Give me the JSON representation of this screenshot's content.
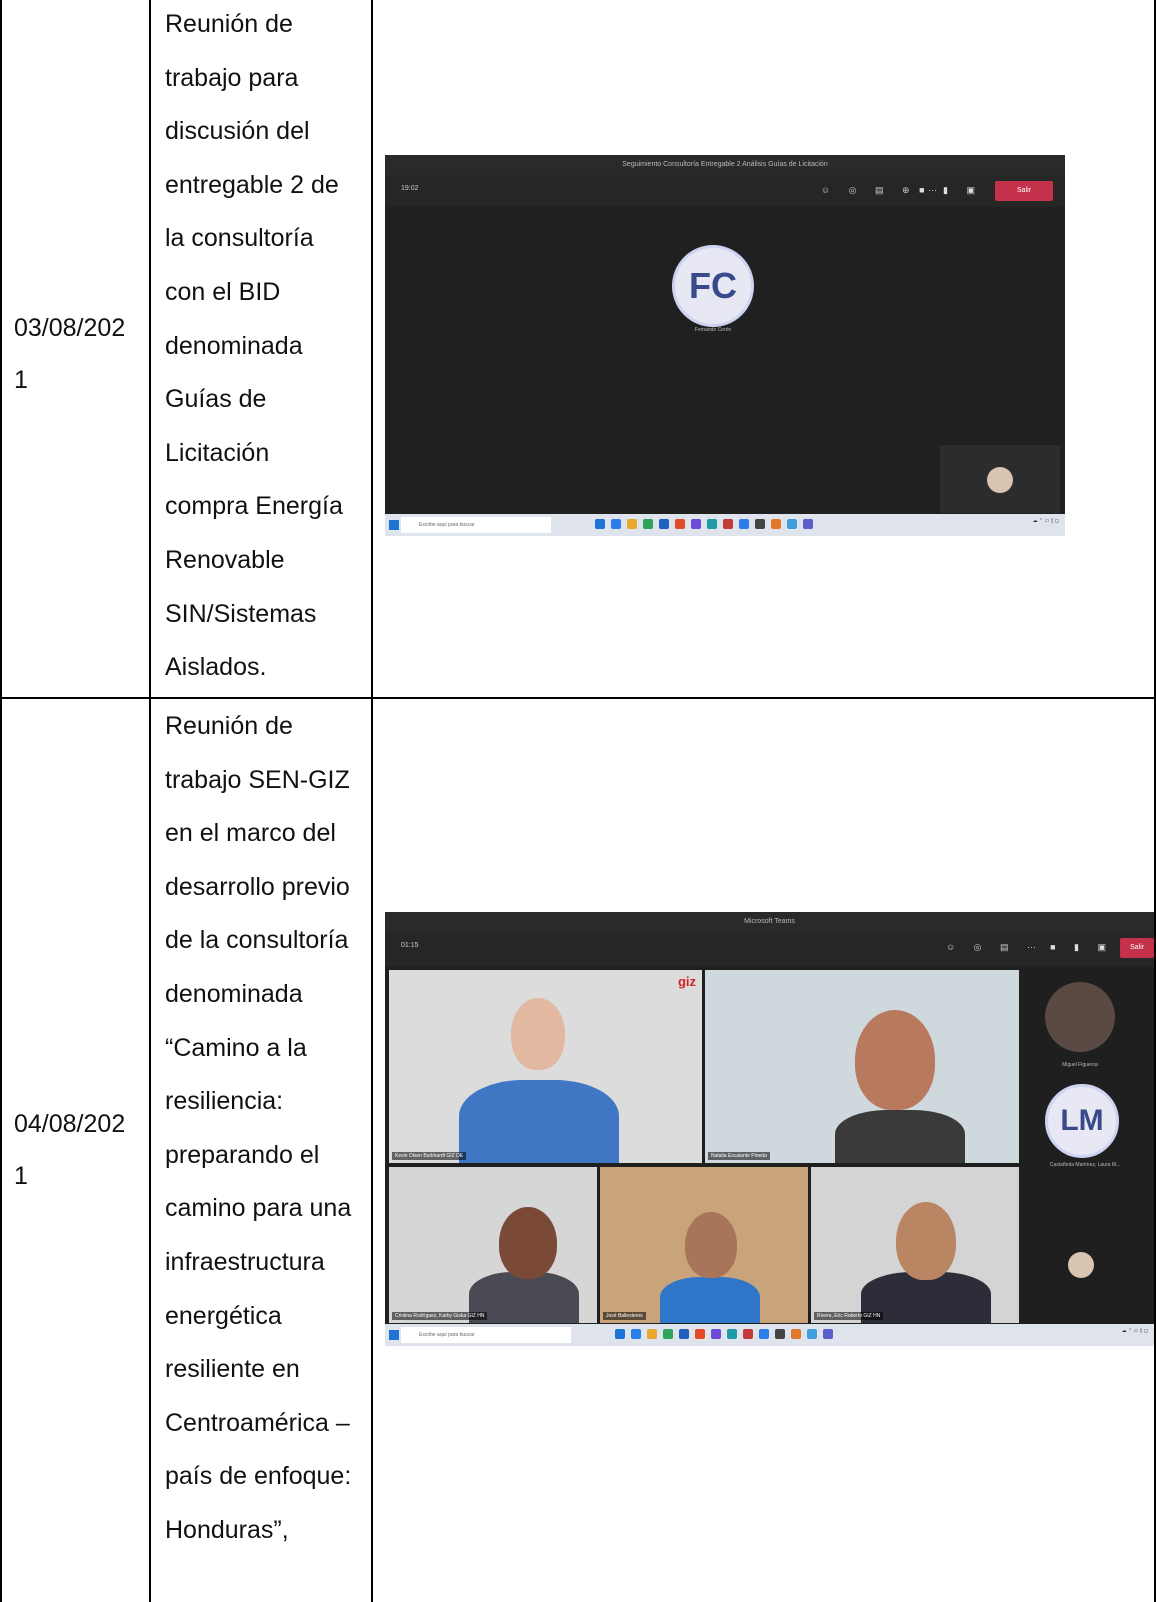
{
  "rows": [
    {
      "date_line1": "03/08/202",
      "date_line2": "1",
      "description_lines": [
        "Reunión de",
        "trabajo para",
        "discusión del",
        "entregable 2 de",
        "la consultoría",
        "con el BID",
        "denominada",
        "Guías de",
        "Licitación",
        "compra Energía",
        "Renovable",
        "SIN/Sistemas",
        "Aislados."
      ],
      "screenshot": {
        "window_title": "Seguimiento Consultoría Entregable 2 Análisis Guías de Licitación",
        "timer": "19:02",
        "leave_label": "Salir",
        "avatar_initials": "FC",
        "participant_name": "Fernando Cerón",
        "search_placeholder": "Escribe aquí para buscar"
      }
    },
    {
      "date_line1": "04/08/202",
      "date_line2": "1",
      "description_lines": [
        "Reunión de",
        "trabajo SEN-GIZ",
        "en el marco del",
        "desarrollo previo",
        "de la consultoría",
        "denominada",
        "“Camino a la",
        "resiliencia:",
        "preparando el",
        "camino para una",
        "infraestructura",
        "energética",
        "resiliente en",
        "Centroamérica –",
        "país de enfoque:",
        "Honduras”,"
      ],
      "screenshot": {
        "window_title": "Microsoft Teams",
        "timer": "01:15",
        "leave_label": "Salir",
        "giz_logo": "giz",
        "side_avatar_initials": "LM",
        "participant_1": "Kevin Olsen Burkhardt GIZ DE",
        "participant_2": "Natalia Escalante Pineda",
        "participant_3": "Miguel Figueroa",
        "participant_4": "Castañeda Martínez, Laura M...",
        "participant_5": "Cristina Rodríguez, Kathy Giska GIZ HN",
        "participant_6": "José Ballesteros",
        "participant_7": "Rivera, Eric Roberto GIZ HN",
        "search_placeholder": "Escribe aquí para buscar"
      }
    }
  ]
}
